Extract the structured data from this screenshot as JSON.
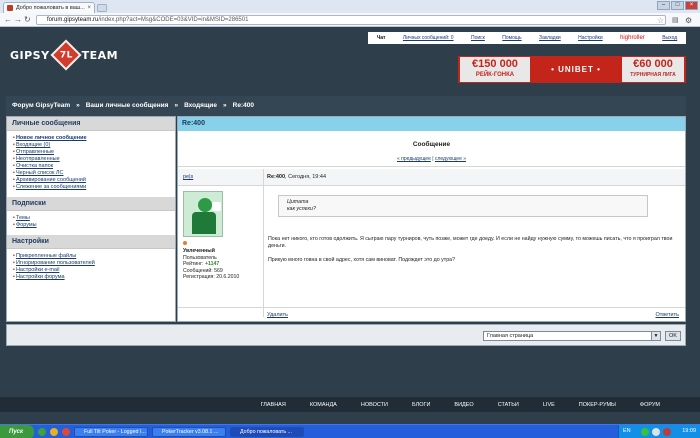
{
  "browser": {
    "tab_title": "Добро пожаловать в ваш...",
    "url_host": "forum.gipsyteam.ru",
    "url_path": "/index.php?act=Msg&CODE=03&VID=in&MSID=286501"
  },
  "site": {
    "logo_left": "GIPSY",
    "logo_mark": "7L",
    "logo_right": "TEAM"
  },
  "topnav": [
    "Чат",
    "Личных сообщений: 0",
    "Поиск",
    "Помощь",
    "Закладки",
    "Настройки",
    "highroller",
    "Выход"
  ],
  "banner": {
    "left_amount": "€150 000",
    "left_label": "РЕЙК-ГОНКА",
    "middle": "• UNIBET •",
    "right_amount": "€60 000",
    "right_label": "ТУРНИРНАЯ ЛИГА"
  },
  "breadcrumb": [
    "Форум GipsyTeam",
    "Ваши личные сообщения",
    "Входящие",
    "Re:400"
  ],
  "breadcrumb_sep": "»",
  "sidebar": {
    "sections": [
      {
        "title": "Личные сообщения",
        "items": [
          "Новое личное сообщение",
          "Входящие (0)",
          "Отправленные",
          "Неотправленные",
          "Очистка папок",
          "Черный список ЛС",
          "Архивирование сообщений",
          "Слежение за сообщениями"
        ]
      },
      {
        "title": "Подписки",
        "items": [
          "Темы",
          "Форумы"
        ]
      },
      {
        "title": "Настройки",
        "items": [
          "Прикрепленные файлы",
          "Игнорирование пользователей",
          "Настройки e-mail",
          "Настройки форума"
        ]
      }
    ]
  },
  "message": {
    "panel_title": "Re:400",
    "header": "Сообщение",
    "prev": "« предыдущее",
    "nav_sep": "|",
    "next": "следующее »",
    "author": "pe|s",
    "post_title": "Re:400",
    "post_date": ", Сегодня, 19:44",
    "quote_label": "Цитата",
    "quote_text": "как успехи?",
    "body_line1": "Пока нет никого, кто готов одолжить. Я сыграю пару турниров, чуть позже, может где доеду. И если не найду нужную сумму, то можешь писать, что я проиграл твои деньги.",
    "body_line2": "Прикую много говна в свой адрес, хотя сам виноват. Подождет это до утра?",
    "user_rank": "Увлеченный",
    "user_group": "Пользователь",
    "rating_label": "Рейтинг: ",
    "rating_value": "+1147",
    "posts": "Сообщений: 569",
    "registered": "Регистрация: 20.6.2010",
    "delete": "Удалить",
    "reply": "Ответить"
  },
  "jump": {
    "selected": "Главная страница",
    "go": "OK"
  },
  "footer_nav": [
    "ГЛАВНАЯ",
    "КОМАНДА",
    "НОВОСТИ",
    "БЛОГИ",
    "ВИДЕО",
    "СТАТЬИ",
    "LIVE",
    "ПОКЕР-РУМЫ",
    "ФОРУМ"
  ],
  "taskbar": {
    "start": "Пуск",
    "buttons": [
      "Full Tilt Poker - Logged I...",
      "PokerTracker v3.08.1 ...",
      "Добро пожаловать ..."
    ],
    "lang": "EN",
    "clock": "19:09"
  },
  "colors": {
    "page_bg": "#2e3f4b",
    "header_bar": "#344654",
    "panel_title": "#88d1ea",
    "link": "#1a3a72"
  }
}
